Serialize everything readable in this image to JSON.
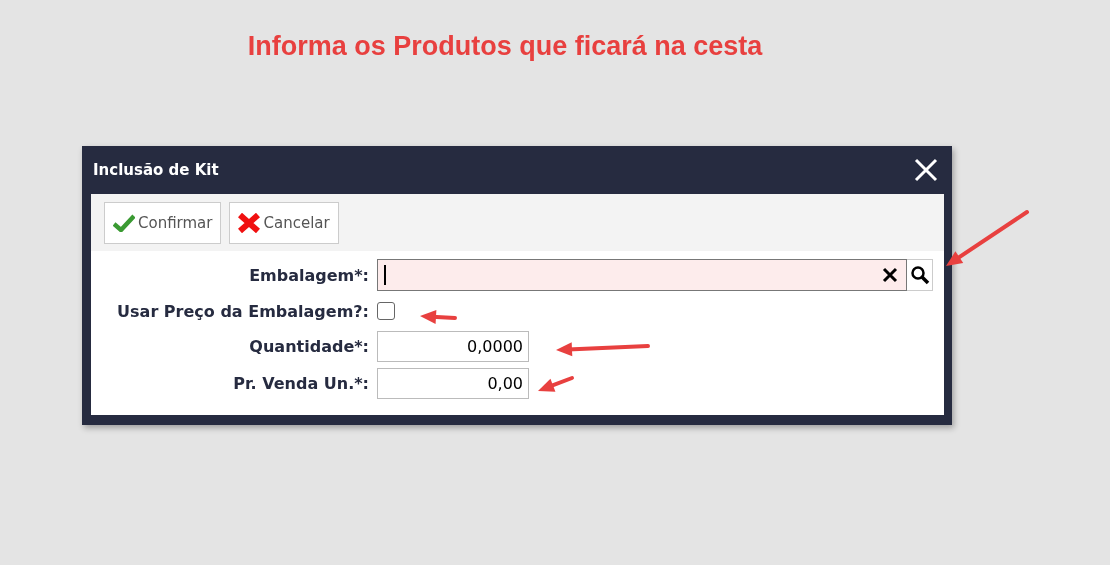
{
  "annotation": {
    "text": "Informa os Produtos que ficará na cesta"
  },
  "dialog": {
    "title": "Inclusão de Kit",
    "buttons": [
      {
        "label": "Confirmar",
        "kind": "confirm"
      },
      {
        "label": "Cancelar",
        "kind": "cancel"
      }
    ],
    "fields": [
      {
        "kind": "lookup",
        "label": "Embalagem*:",
        "focused": true
      },
      {
        "kind": "checkbox",
        "label": "Usar Preço da Embalagem?:",
        "checked": false
      },
      {
        "kind": "number",
        "label": "Quantidade*:",
        "value": "0,0000"
      },
      {
        "kind": "number",
        "label": "Pr. Venda Un.*:",
        "value": "0,00"
      }
    ]
  }
}
